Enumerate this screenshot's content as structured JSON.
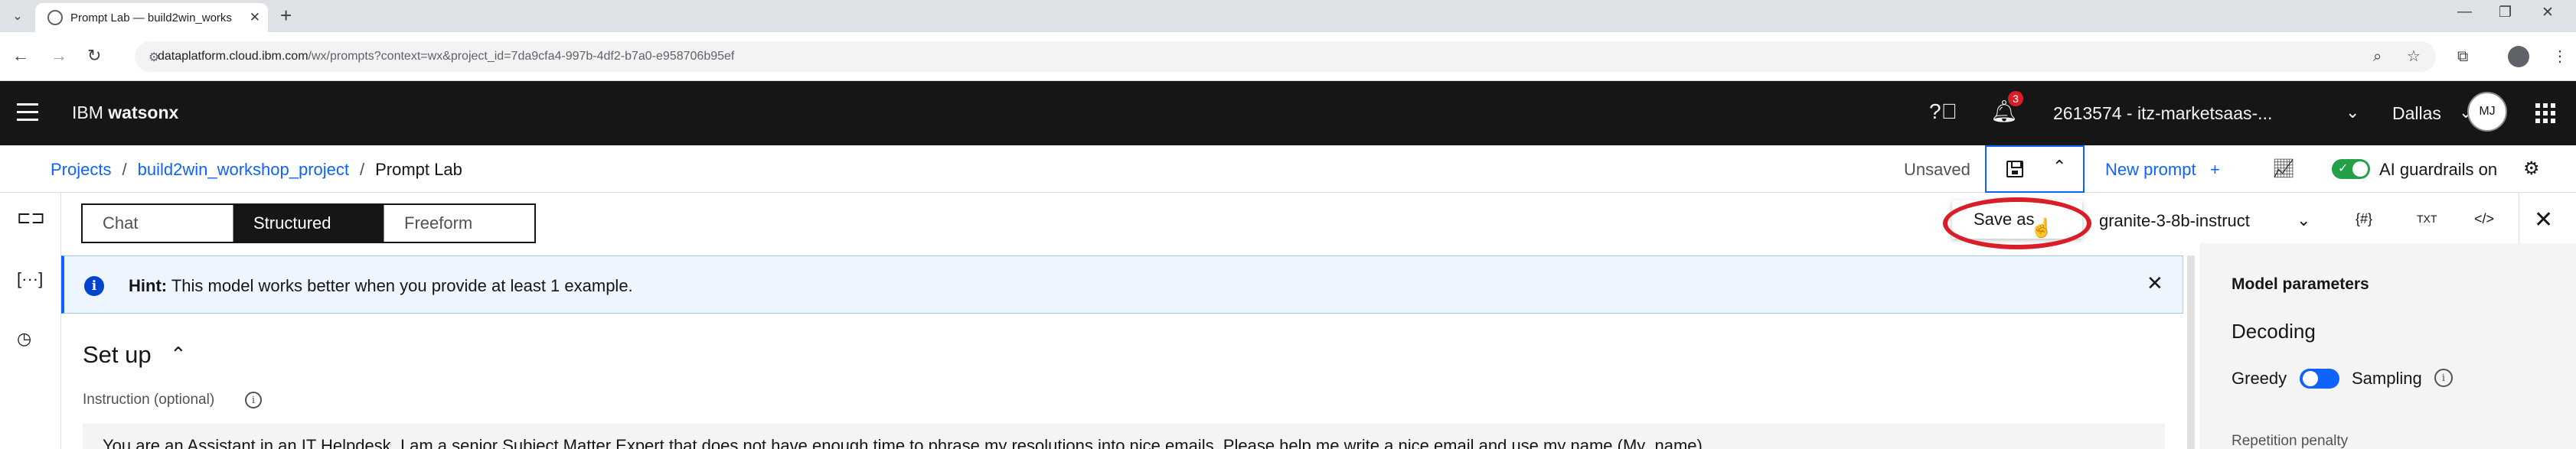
{
  "browser": {
    "tab_title": "Prompt Lab — build2win_works",
    "url_host": "dataplatform.cloud.ibm.com",
    "url_path": "/wx/prompts?context=wx&project_id=7da9cfa4-997b-4df2-b7a0-e958706b95ef"
  },
  "header": {
    "brand_prefix": "IBM ",
    "brand_name": "watsonx",
    "notification_count": "3",
    "account": "2613574 - itz-marketsaas-...",
    "region": "Dallas",
    "avatar_initials": "MJ"
  },
  "breadcrumb": {
    "items": [
      "Projects",
      "build2win_workshop_project",
      "Prompt Lab"
    ],
    "separator": "/"
  },
  "toolbar": {
    "status": "Unsaved",
    "new_prompt_label": "New prompt",
    "guardrails_label": "AI guardrails on",
    "guardrails_enabled": true
  },
  "mode_switch": {
    "options": [
      "Chat",
      "Structured",
      "Freeform"
    ],
    "selected": "Structured"
  },
  "save_menu": {
    "item_label": "Save as"
  },
  "model": {
    "selected": "granite-3-8b-instruct"
  },
  "model_row_icons": {
    "variables": "{#}",
    "text": "TXT",
    "code": "</>"
  },
  "hint": {
    "label": "Hint:",
    "message": "This model works better when you provide at least 1 example."
  },
  "setup": {
    "title": "Set up",
    "instruction_label": "Instruction (optional)",
    "instruction_text": "You are an Assistant in an IT Helpdesk. I am a senior Subject Matter Expert that does not have enough time to phrase my resolutions into nice emails. Please help me write a nice email and use my name (My_name)"
  },
  "parameters": {
    "title": "Model parameters",
    "decoding_label": "Decoding",
    "greedy_label": "Greedy",
    "sampling_label": "Sampling",
    "sampling_enabled": true,
    "repetition_label": "Repetition penalty"
  },
  "colors": {
    "accent": "#0f62fe",
    "header_bg": "#161616",
    "guardrails_on": "#24a148",
    "callout": "#da1e28"
  }
}
